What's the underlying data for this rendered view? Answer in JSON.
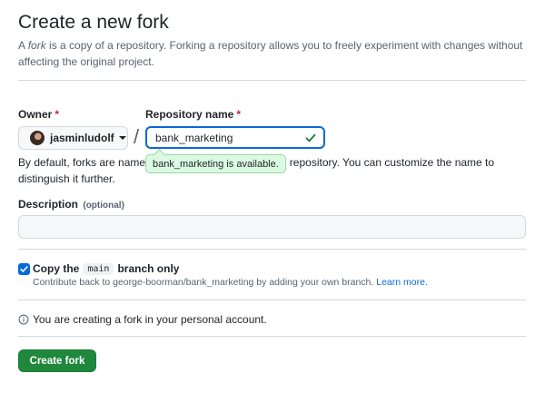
{
  "page": {
    "title": "Create a new fork",
    "subtitle_em": "fork",
    "subtitle_pre": "A ",
    "subtitle_post": " is a copy of a repository. Forking a repository allows you to freely experiment with changes without affecting the original project."
  },
  "owner": {
    "label": "Owner",
    "required_mark": "*",
    "username": "jasminludolf"
  },
  "separator": "/",
  "repository": {
    "label": "Repository name",
    "required_mark": "*",
    "value": "bank_marketing",
    "availability": "bank_marketing is available."
  },
  "hint": "By default, forks are named the same as their upstream repository. You can customize the name to distinguish it further.",
  "description": {
    "label": "Description",
    "optional": "(optional)",
    "value": ""
  },
  "copy_branch": {
    "label_pre": "Copy the",
    "branch": "main",
    "label_post": "branch only",
    "checked": true,
    "help_text": "Contribute back to george-boorman/bank_marketing by adding your own branch.",
    "learn_more": "Learn more."
  },
  "info": "You are creating a fork in your personal account.",
  "submit": {
    "label": "Create fork"
  },
  "colors": {
    "primary_button": "#1f883d",
    "accent_blue": "#0969da",
    "success_green": "#1a7f37",
    "required_red": "#d1242f"
  },
  "icons": {
    "check": "check-icon",
    "caret": "triangle-down-icon",
    "info": "info-icon"
  }
}
